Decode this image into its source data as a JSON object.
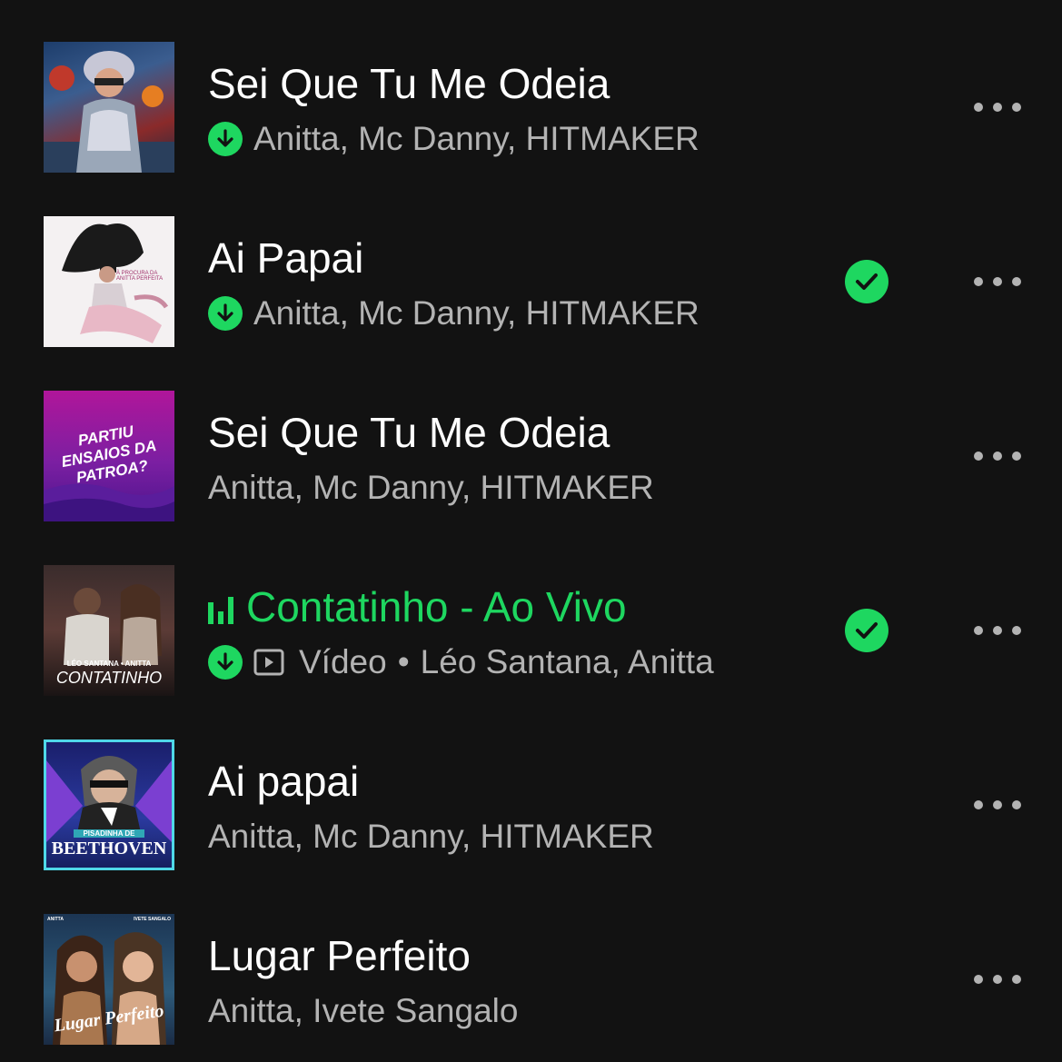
{
  "colors": {
    "background": "#121212",
    "accent": "#1ed760",
    "secondary_text": "#b3b3b3"
  },
  "tracks": [
    {
      "title": "Sei Que Tu Me Odeia",
      "artists": "Anitta, Mc Danny, HITMAKER",
      "downloaded": true,
      "liked": false,
      "playing": false
    },
    {
      "title": "Ai Papai",
      "artists": "Anitta, Mc Danny, HITMAKER",
      "downloaded": true,
      "liked": true,
      "playing": false,
      "art_text": "À PROCURA DA ANITTA PERFEITA"
    },
    {
      "title": "Sei Que Tu Me Odeia",
      "artists": "Anitta, Mc Danny, HITMAKER",
      "downloaded": false,
      "liked": false,
      "playing": false,
      "art_text": "PARTIU ENSAIOS DA PATROA?"
    },
    {
      "title": "Contatinho - Ao Vivo",
      "video_label": "Vídeo",
      "separator": "•",
      "artists": "Léo Santana, Anitta",
      "downloaded": true,
      "liked": true,
      "playing": true,
      "art_text": "LÉO SANTANA • ANITTA",
      "art_title": "CONTATINHO"
    },
    {
      "title": "Ai papai",
      "artists": "Anitta, Mc Danny, HITMAKER",
      "downloaded": false,
      "liked": false,
      "playing": false,
      "art_text": "PISADINHA DE",
      "art_title": "BEETHOVEN"
    },
    {
      "title": "Lugar Perfeito",
      "artists": "Anitta, Ivete Sangalo",
      "downloaded": false,
      "liked": false,
      "playing": false,
      "art_text_left": "ANITTA",
      "art_text_right": "IVETE SANGALO",
      "art_title": "Lugar Perfeito"
    }
  ],
  "icons": {
    "download": "download-arrow-icon",
    "liked": "check-icon",
    "more": "more-options-icon",
    "video": "video-icon",
    "playing": "equalizer-icon"
  }
}
